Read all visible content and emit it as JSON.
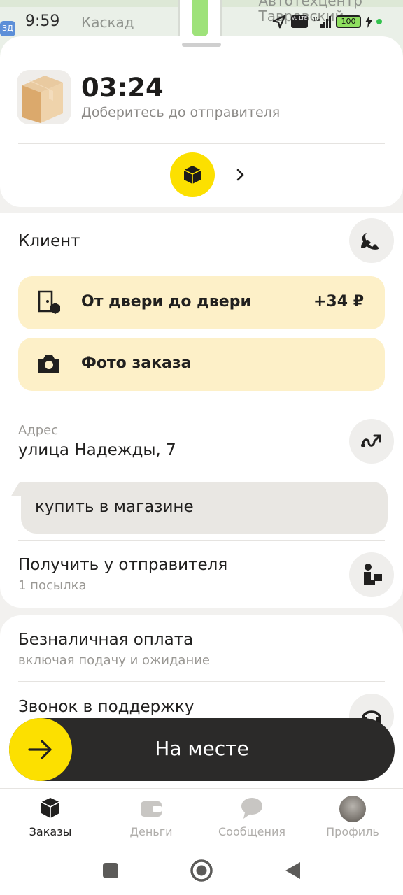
{
  "status_bar": {
    "time": "9:59",
    "map_label_left": "Каскад",
    "map_label_right_line1": "Автотехцентр",
    "map_label_right_line2": "Тавровский",
    "network": "4G",
    "lte_badge": "Vo LTE",
    "battery": "100"
  },
  "order": {
    "timer": "03:24",
    "timer_subtitle": "Доберитесь до отправителя"
  },
  "client": {
    "label": "Клиент"
  },
  "promos": [
    {
      "label": "От двери до двери",
      "price": "+34 ₽"
    },
    {
      "label": "Фото заказа"
    }
  ],
  "address": {
    "caption": "Адрес",
    "value": "улица Надежды, 7"
  },
  "comment": {
    "text": "купить в магазине"
  },
  "pickup": {
    "title": "Получить у отправителя",
    "subtitle": "1 посылка"
  },
  "payment": {
    "title": "Безналичная оплата",
    "subtitle": "включая подачу и ожидание"
  },
  "support": {
    "title": "Звонок в поддержку"
  },
  "slide_button": {
    "label": "На месте"
  },
  "tabs": [
    {
      "label": "Заказы",
      "active": true
    },
    {
      "label": "Деньги",
      "active": false
    },
    {
      "label": "Сообщения",
      "active": false
    },
    {
      "label": "Профиль",
      "active": false
    }
  ],
  "colors": {
    "brand_yellow": "#fce000",
    "promo_bg": "#fdf0c8",
    "dark": "#2b2a29"
  }
}
